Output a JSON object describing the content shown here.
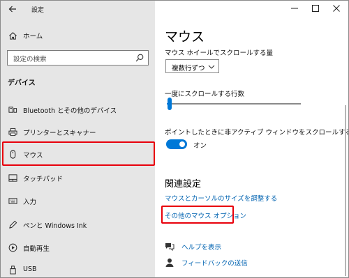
{
  "window": {
    "title": "設定"
  },
  "sidebar": {
    "home_label": "ホーム",
    "search_placeholder": "設定の検索",
    "section_title": "デバイス",
    "items": [
      {
        "label": "Bluetooth とその他のデバイス",
        "icon": "bluetooth-devices-icon"
      },
      {
        "label": "プリンターとスキャナー",
        "icon": "printer-icon"
      },
      {
        "label": "マウス",
        "icon": "mouse-icon",
        "selected": true
      },
      {
        "label": "タッチパッド",
        "icon": "touchpad-icon"
      },
      {
        "label": "入力",
        "icon": "keyboard-icon"
      },
      {
        "label": "ペンと Windows Ink",
        "icon": "pen-icon"
      },
      {
        "label": "自動再生",
        "icon": "autoplay-icon"
      },
      {
        "label": "USB",
        "icon": "usb-icon"
      }
    ]
  },
  "main": {
    "title": "マウス",
    "wheel_label": "マウス ホイールでスクロールする量",
    "wheel_value": "複数行ずつ",
    "lines_label": "一度にスクロールする行数",
    "lines_slider_fraction": 0.02,
    "inactive_label": "ポイントしたときに非アクティブ ウィンドウをスクロールする",
    "inactive_toggle": "オン",
    "related_title": "関連設定",
    "link_cursor_size": "マウスとカーソルのサイズを調整する",
    "link_other_options": "その他のマウス オプション",
    "help_label": "ヘルプを表示",
    "feedback_label": "フィードバックの送信"
  },
  "colors": {
    "accent": "#0078d7",
    "link": "#0063b1",
    "highlight": "#e8000b",
    "sidebar_bg": "#e6e6e6"
  }
}
